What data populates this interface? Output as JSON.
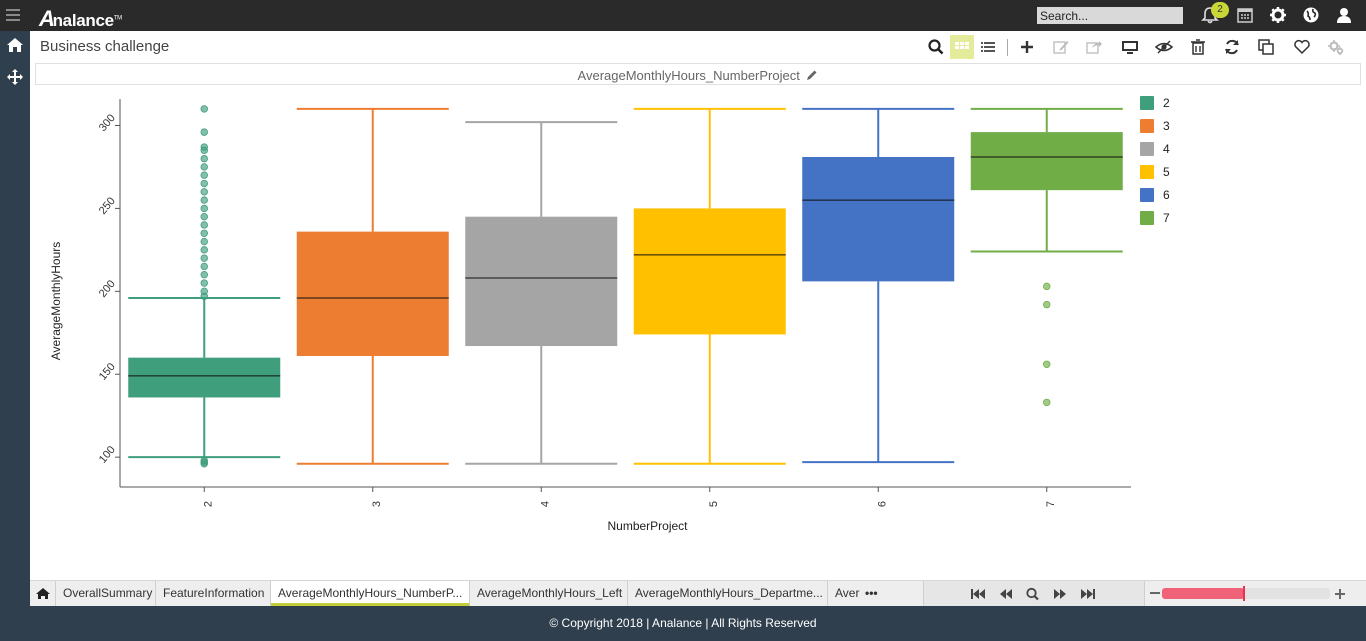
{
  "app": {
    "logo_text": "nalance",
    "logo_mark": "A",
    "logo_tm": "TM",
    "search_placeholder": "Search...",
    "notification_count": "2"
  },
  "page": {
    "title": "Business challenge",
    "chart_title": "AverageMonthlyHours_NumberProject"
  },
  "toolbar": {
    "icons": [
      "search-icon",
      "grid-view-icon",
      "list-view-icon",
      "add-icon",
      "edit-icon",
      "share-icon",
      "present-icon",
      "hide-icon",
      "delete-icon",
      "refresh-icon",
      "copy-icon",
      "favorite-icon",
      "settings-icon"
    ]
  },
  "tabs": [
    {
      "label": "OverallSummary"
    },
    {
      "label": "FeatureInformation"
    },
    {
      "label": "AverageMonthlyHours_NumberP..."
    },
    {
      "label": "AverageMonthlyHours_Left"
    },
    {
      "label": "AverageMonthlyHours_Departme..."
    },
    {
      "label": "Aver"
    }
  ],
  "tabs_more": "•••",
  "footer": {
    "copyright": "© Copyright 2018 | Analance | All Rights Reserved"
  },
  "chart_data": {
    "type": "box",
    "xlabel": "NumberProject",
    "ylabel": "AverageMonthlyHours",
    "ylim": [
      82,
      322
    ],
    "yticks": [
      100,
      150,
      200,
      250,
      300
    ],
    "categories": [
      "2",
      "3",
      "4",
      "5",
      "6",
      "7"
    ],
    "legend_position": "right",
    "grid": false,
    "boxes": [
      {
        "category": "2",
        "color": "#3f9e7c",
        "min": 100,
        "q1": 136,
        "median": 149,
        "q3": 160,
        "max": 196,
        "outliers": [
          96,
          97,
          98,
          197,
          200,
          205,
          210,
          215,
          220,
          225,
          230,
          235,
          240,
          245,
          250,
          255,
          260,
          265,
          270,
          275,
          280,
          285,
          287,
          296,
          310
        ]
      },
      {
        "category": "3",
        "color": "#ed7d31",
        "min": 96,
        "q1": 161,
        "median": 196,
        "q3": 236,
        "max": 310,
        "outliers": []
      },
      {
        "category": "4",
        "color": "#a5a5a5",
        "min": 96,
        "q1": 167,
        "median": 208,
        "q3": 245,
        "max": 302,
        "outliers": []
      },
      {
        "category": "5",
        "color": "#ffc000",
        "min": 96,
        "q1": 174,
        "median": 222,
        "q3": 250,
        "max": 310,
        "outliers": []
      },
      {
        "category": "6",
        "color": "#4472c4",
        "min": 97,
        "q1": 206,
        "median": 255,
        "q3": 281,
        "max": 310,
        "outliers": []
      },
      {
        "category": "7",
        "color": "#70ad47",
        "min": 224,
        "q1": 261,
        "median": 281,
        "q3": 296,
        "max": 310,
        "outliers": [
          203,
          192,
          156,
          133
        ]
      }
    ]
  }
}
